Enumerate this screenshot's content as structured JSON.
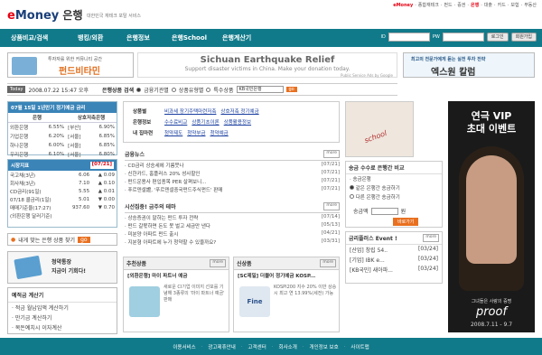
{
  "header": {
    "logo_e": "e",
    "logo_money": "Money",
    "logo_ko": " 은행",
    "tagline": "대한민국 재테크 포탈 서비스",
    "topnav": [
      "eMoney",
      "·",
      "종합재테크",
      "·",
      "펀드",
      "·",
      "증권",
      "·",
      "은행",
      "·",
      "대출",
      "·",
      "카드",
      "·",
      "보험",
      "·",
      "부동산"
    ],
    "topnav_current": "은행",
    "topnav_brand": "eMoney"
  },
  "gnb": {
    "items": [
      "상품비교/검색",
      "뱅킹/외환",
      "은행정보",
      "은행School",
      "은행계산기"
    ]
  },
  "login": {
    "id_label": "ID",
    "pw_label": "PW",
    "login_btn": "로그인",
    "join_btn": "회원가입"
  },
  "banners": {
    "left": {
      "line1": "투자자를 위한 커뮤니티 공간",
      "line2": "펀드비타민"
    },
    "center": {
      "title": "Sichuan Earthquake Relief",
      "sub": "Support disaster victims in China. Make your donation today.",
      "ads": "Public Service Ads by Google"
    },
    "right": {
      "line1": "최고의 전문가에게 듣는 실전 투자 전략",
      "line2": "엑스원 칼럼"
    }
  },
  "datebar": {
    "today": "Today",
    "date": "2008.07.22 15:47 오후",
    "search_label": "은행상품 검색",
    "radios": [
      "금융기관별",
      "상품유형별",
      "특수상품"
    ],
    "selected_radio": 0,
    "select_value": "KB국민은행",
    "go": "go"
  },
  "rates": {
    "title": "07월 15일 1년만기 정기예금 금리",
    "headers": [
      "은행",
      "상호저축은행"
    ],
    "rows": [
      [
        "외환은행",
        "6.55%",
        "[부산]",
        "6.90%"
      ],
      [
        "기업은행",
        "6.20%",
        "[서울]",
        "6.85%"
      ],
      [
        "하나은행",
        "6.00%",
        "[서울]",
        "6.85%"
      ],
      [
        "우리은행",
        "6.10%",
        "[서울]",
        "6.80%"
      ]
    ]
  },
  "market": {
    "title": "시장지표",
    "date": "[07/21]",
    "rows": [
      {
        "name": "국고채(3년)",
        "value": "6.06",
        "change": "▲ 0.09",
        "dir": "up"
      },
      {
        "name": "회사채(3년)",
        "value": "7.10",
        "change": "▲ 0.10",
        "dir": "up"
      },
      {
        "name": "CD금리(91일)",
        "value": "5.55",
        "change": "▲ 0.01",
        "dir": "up"
      },
      {
        "name": "07/18 콜금리(1일)",
        "value": "5.01",
        "change": "▼ 0.00",
        "dir": "dn"
      },
      {
        "name": "매매기준율(17:27)",
        "value": "937.60",
        "change": "▼ 0.70",
        "dir": "dn"
      },
      {
        "name": "(외환은행 달러기준)",
        "value": "",
        "change": "",
        "dir": ""
      }
    ]
  },
  "findbank": {
    "label": "내게 맞는 은행 상품 찾기",
    "go": "go"
  },
  "app": {
    "line1": "청약통장",
    "line2": "지금이 기회다!"
  },
  "calc": {
    "title": "예적금 계산기",
    "items": [
      "적금 월납입액 계산하기",
      "만기금 계산하기",
      "목돈예치시 이자계산"
    ]
  },
  "category": {
    "rows": [
      {
        "label": "상품별",
        "links": [
          "비과세 장기주택마련저축",
          "상호저축 정기예금"
        ]
      },
      {
        "label": "은행정보",
        "links": [
          "수수료비교",
          "상품기초이론",
          "상품활용정보"
        ]
      },
      {
        "label": "내 집마련",
        "links": [
          "청약제도",
          "청약부금",
          "청약예금"
        ]
      }
    ]
  },
  "photo": {
    "text": "school"
  },
  "news": {
    "title": "금융뉴스",
    "more": "more",
    "items": [
      {
        "t": "CD금리 상승세에 기름붓나",
        "d": "[07/21]"
      },
      {
        "t": "신한카드, 홈플러스 20% 성사할인",
        "d": "[07/21]"
      },
      {
        "t": "펀드운용사 편입종목 PER 살펴보니...",
        "d": "[07/21]"
      },
      {
        "t": "푸르덴셜證, '푸르덴셜중국펀드주식펀드' 판매",
        "d": "[07/21]"
      }
    ]
  },
  "theme": {
    "title": "시선집중! 금주의 테마",
    "more": "more",
    "items": [
      {
        "t": "상승증권이 말하는 펀드 투자 전략",
        "d": "[07/14]"
      },
      {
        "t": "펀드 갈몫하면 돈도 못 벌고 세금만 낸다",
        "d": "[05/13]"
      },
      {
        "t": "미분양 아파트 펀드 출시",
        "d": "[04/21]"
      },
      {
        "t": "지분형 아파트에 누가 청약할 수 있을까요?",
        "d": "[03/31]"
      }
    ]
  },
  "prod_left": {
    "title": "추천상품",
    "more": "more",
    "name": "[외환은행] 마이 파트너 예금",
    "desc": "새로운 CI기업 이미지 선포를 기념해 3종류의 '마이 파트너 예금' 판매"
  },
  "prod_right": {
    "title": "신상품",
    "more": "more",
    "name": "[SC제일] 더블어 정기예금 KOSP...",
    "desc": "KOSPI200 지수 20% 이만 상승 시 최고 연 13.99%(세전) 가능",
    "img_label": "Fine"
  },
  "compare": {
    "title": "송금 수수료 은행간 비교",
    "options": [
      "송금은행",
      "같은 은행간 송금하기",
      "다른 은행간 송금하기"
    ],
    "selected": 1,
    "amount_label": "송금액",
    "unit": "원",
    "button": "바로가기"
  },
  "events": {
    "title": "금리플러스 Event !",
    "more": "more",
    "items": [
      {
        "t": "[산업] 창립 54..",
        "d": "[03/24]"
      },
      {
        "t": "[기업] IBK e...",
        "d": "[03/24]"
      },
      {
        "t": "[KB국민] 새아파...",
        "d": "[03/24]"
      }
    ]
  },
  "ad": {
    "line1": "연극 VIP",
    "line2": "초대 이벤트",
    "line3": "그녀들은 사랑의 증명",
    "line4": "proof",
    "line5": "2008.7.11 - 9.7"
  },
  "footer": {
    "items": [
      "이용서비스",
      "광고제휴안내",
      "고객센터",
      "회사소개",
      "개인정보 보호",
      "사이트맵"
    ]
  }
}
